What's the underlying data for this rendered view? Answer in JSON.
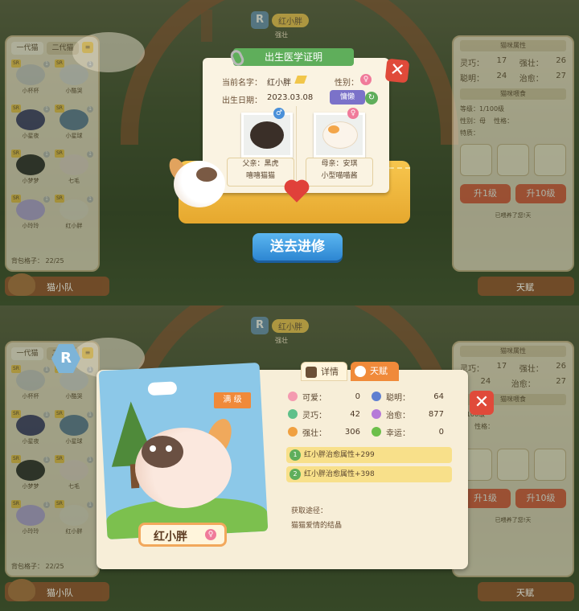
{
  "background_layers": {
    "left_panel": {
      "gen_tabs": [
        "一代猫",
        "二代猫"
      ],
      "cats": [
        {
          "name": "小杯杯",
          "color": "#c8c8c8"
        },
        {
          "name": "小酷哭",
          "color": "#d8d8d8"
        },
        {
          "name": "小星夜",
          "color": "#3a3a6a"
        },
        {
          "name": "小星球",
          "color": "#5a7a9a"
        },
        {
          "name": "小梦梦",
          "color": "#2a2a2a"
        },
        {
          "name": "七毛",
          "color": "#e8d8d0"
        },
        {
          "name": "小玲玲",
          "color": "#b8a8e0"
        },
        {
          "name": "红小胖",
          "color": "#e8e0d0"
        }
      ],
      "slots_label": "背包格子：",
      "slots_value": "22/25",
      "team_label": "猫小队"
    },
    "right_panel": {
      "attr_title": "猫咪属性",
      "attrs": [
        {
          "label": "灵巧：",
          "value": "17"
        },
        {
          "label": "强壮：",
          "value": "26"
        },
        {
          "label": "聪明：",
          "value": "24"
        },
        {
          "label": "治愈：",
          "value": "27"
        }
      ],
      "feed_title": "猫咪喂食",
      "level_label": "等级：",
      "level_value": "1/100级",
      "gender_label": "性别：",
      "gender_value": "母",
      "trait_label": "性格：",
      "special_label": "特质：",
      "upgrade1": "升1级",
      "upgrade10": "升10级",
      "note": "已喂养了您!天",
      "talent_label": "天赋"
    },
    "top_name": {
      "rank": "R",
      "name": "红小胖",
      "sub": "强壮"
    }
  },
  "certificate": {
    "title": "出生医学证明",
    "name_label": "当前名字：",
    "name_value": "红小胖",
    "gender_label": "性别：",
    "birth_label": "出生日期：",
    "birth_value": "2023.03.08",
    "trait_value": "慵懒",
    "father_label": "父亲：黑虎",
    "father_breed": "嘻嘻猫猫",
    "mother_label": "母亲：安琪",
    "mother_breed": "小型喵喵酱",
    "send_button": "送去进修"
  },
  "detail": {
    "rank": "R",
    "max_level": "满 级",
    "cat_name": "红小胖",
    "tabs": [
      "详情",
      "天赋"
    ],
    "stats": [
      [
        {
          "label": "可爱：",
          "value": "0",
          "color": "#f49ab0"
        },
        {
          "label": "聪明：",
          "value": "64",
          "color": "#5f7fd0"
        }
      ],
      [
        {
          "label": "灵巧：",
          "value": "42",
          "color": "#5fc08a"
        },
        {
          "label": "治愈：",
          "value": "877",
          "color": "#b67ad8"
        }
      ],
      [
        {
          "label": "强壮：",
          "value": "306",
          "color": "#f0a040"
        },
        {
          "label": "幸运：",
          "value": "0",
          "color": "#6cbf4a"
        }
      ]
    ],
    "bonuses": [
      {
        "num": "1",
        "text": "红小胖治愈属性+299"
      },
      {
        "num": "2",
        "text": "红小胖治愈属性+398"
      }
    ],
    "obtain_label": "获取途径：",
    "obtain_value": "猫猫爱情的结晶"
  }
}
